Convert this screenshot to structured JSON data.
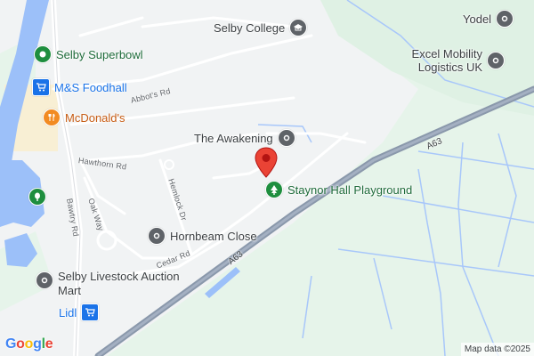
{
  "map": {
    "places": [
      {
        "name": "Selby College",
        "icon": "school-icon",
        "color": "#5f6368"
      },
      {
        "name": "Selby Superbowl",
        "icon": "bowling-icon",
        "color": "#1e8e3e"
      },
      {
        "name": "M&S Foodhall",
        "icon": "shopping-cart-icon",
        "color": "#1a73e8"
      },
      {
        "name": "McDonald's",
        "icon": "restaurant-icon",
        "color": "#f28b22"
      },
      {
        "name": "The Awakening",
        "icon": "place-icon",
        "color": "#5f6368"
      },
      {
        "name": "Staynor Hall Playground",
        "icon": "tree-icon",
        "color": "#1e8e3e"
      },
      {
        "name": "Hornbeam Close",
        "icon": "place-icon",
        "color": "#5f6368"
      },
      {
        "name": "Selby Livestock Auction Mart",
        "icon": "place-icon",
        "color": "#5f6368"
      },
      {
        "name": "Lidl",
        "icon": "shopping-cart-icon",
        "color": "#1a73e8"
      },
      {
        "name": "Yodel",
        "icon": "place-icon",
        "color": "#5f6368"
      },
      {
        "name": "Excel Mobility Logistics UK",
        "icon": "place-icon",
        "color": "#5f6368"
      },
      {
        "name": "",
        "icon": "park-icon",
        "color": "#1e8e3e"
      }
    ],
    "roads": [
      "Abbot's Rd",
      "Hawthorn Rd",
      "Oak Way",
      "Hemlock Dr",
      "Bawtry Rd",
      "Cedar Rd"
    ],
    "highway": "A63",
    "marker": {
      "icon": "location-pin-icon",
      "color": "#ea4335"
    },
    "logo": {
      "letters": [
        "G",
        "o",
        "o",
        "g",
        "l",
        "e"
      ]
    },
    "attribution": "Map data ©2025",
    "colors": {
      "land": "#f1f3f4",
      "park": "#e6f4ea",
      "water": "#9cc0f9",
      "road": "#ffffff",
      "highway": "#8a98ab",
      "retail": "#f8efd4"
    }
  }
}
